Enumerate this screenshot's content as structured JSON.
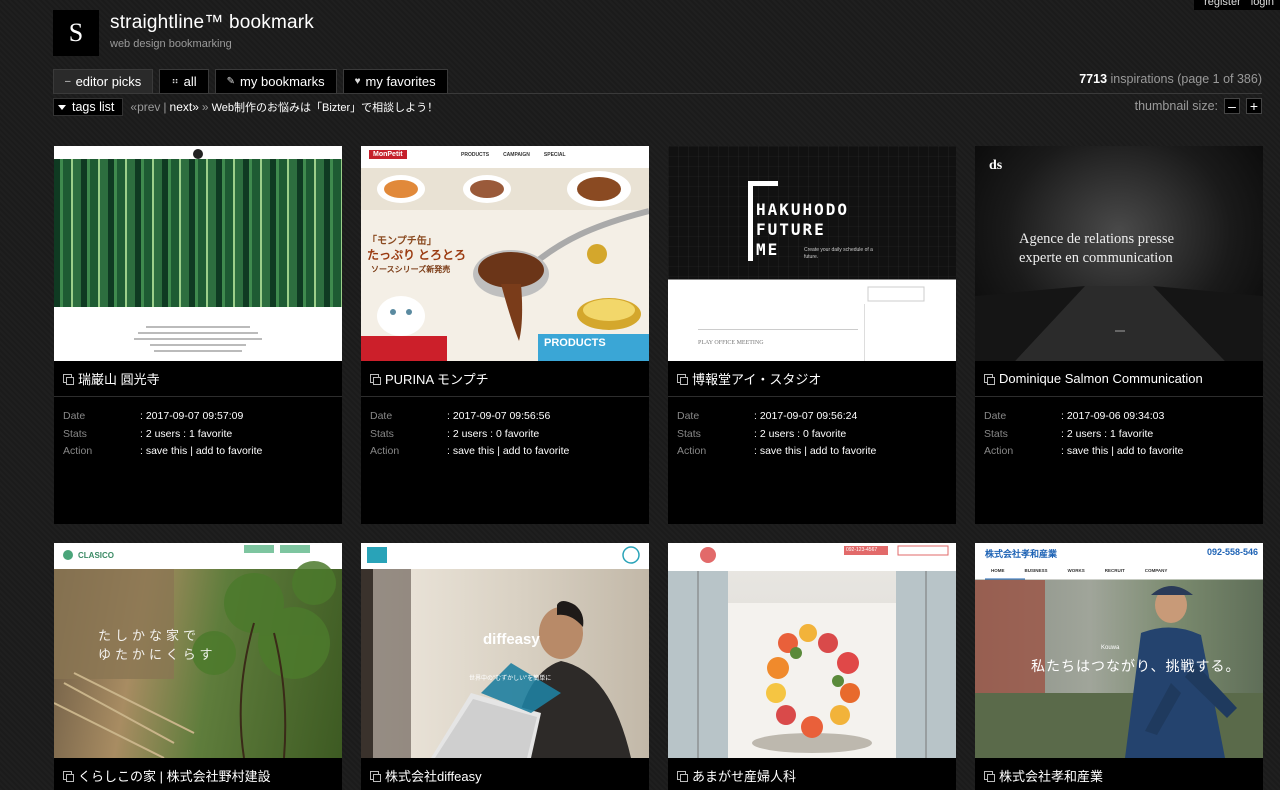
{
  "top_links": {
    "register": "register",
    "login": "login"
  },
  "site": {
    "logo_letter": "S",
    "title": "straightline™ bookmark",
    "subtitle": "web design bookmarking"
  },
  "tabs": [
    {
      "icon": "–",
      "label": "editor picks"
    },
    {
      "icon": "⠶",
      "label": "all"
    },
    {
      "icon": "✎",
      "label": "my bookmarks"
    },
    {
      "icon": "♥",
      "label": "my favorites"
    }
  ],
  "stats": {
    "count": "7713",
    "rest": "inspirations (page 1 of 386)"
  },
  "subbar": {
    "tags_label": "tags list",
    "prev": "«prev",
    "sep": "|",
    "next": "next»",
    "arrow": "»",
    "promo": "Web制作のお悩みは「Bizter」で相談しよう！"
  },
  "thumb_size": {
    "label": "thumbnail size:",
    "minus": "–",
    "plus": "+"
  },
  "labels": {
    "date": "Date",
    "stats": "Stats",
    "action": "Action"
  },
  "cards": [
    {
      "title": "瑞巌山 圓光寺",
      "date": ": 2017-09-07 09:57:09",
      "stats": ": 2 users : 1 favorite",
      "save": "save this",
      "fav": "add to favorite"
    },
    {
      "title": "PURINA モンプチ",
      "date": ": 2017-09-07 09:56:56",
      "stats": ": 2 users : 0 favorite",
      "save": "save this",
      "fav": "add to favorite",
      "thumb": {
        "brand": "MonPetit",
        "nav": [
          "PRODUCTS",
          "CAMPAIGN",
          "SPECIAL"
        ],
        "catch1": "「モンプチ缶」",
        "catch2": "たっぷり",
        "catch3": "とろとろ",
        "catch4": "ソースシリーズ新発売",
        "products": "PRODUCTS"
      }
    },
    {
      "title": "博報堂アイ・スタジオ",
      "date": ": 2017-09-07 09:56:24",
      "stats": ": 2 users : 0 favorite",
      "save": "save this",
      "fav": "add to favorite",
      "thumb": {
        "line1": "HAKUHODO",
        "line2": "FUTURE",
        "line3": "ME",
        "tag": "Create your daily schedule of a future.",
        "meeting": "PLAY OFFICE MEETING"
      }
    },
    {
      "title": "Dominique Salmon Communication",
      "date": ": 2017-09-06 09:34:03",
      "stats": ": 2 users : 1 favorite",
      "save": "save this",
      "fav": "add to favorite",
      "thumb": {
        "logo": "ds",
        "line1": "Agence de relations presse",
        "line2": "experte en communication"
      }
    },
    {
      "title": "くらしこの家 | 株式会社野村建設",
      "thumb": {
        "brand": "CLASICO",
        "catch1": "たしかな家で",
        "catch2": "ゆたかにくらす"
      }
    },
    {
      "title": "株式会社diffeasy",
      "thumb": {
        "logo": "diffeasy",
        "catch": "世界中の\"むずかしい\"を簡単に"
      }
    },
    {
      "title": "あまがせ産婦人科",
      "thumb": {
        "phone": "092-123-4567"
      }
    },
    {
      "title": "株式会社孝和産業",
      "thumb": {
        "brand": "株式会社孝和産業",
        "phone": "092-558-546",
        "nav": [
          "HOME",
          "BUSINESS",
          "WORKS",
          "RECRUIT",
          "COMPANY"
        ],
        "logo": "Kouwa",
        "catch": "私たちはつながり、挑戦する。"
      }
    }
  ],
  "colors": {
    "background": "#1b1b1b",
    "card": "#000000",
    "muted": "#9a9a9a",
    "products_blue": "#3aa6d6",
    "purina_red": "#cc1f2a"
  }
}
